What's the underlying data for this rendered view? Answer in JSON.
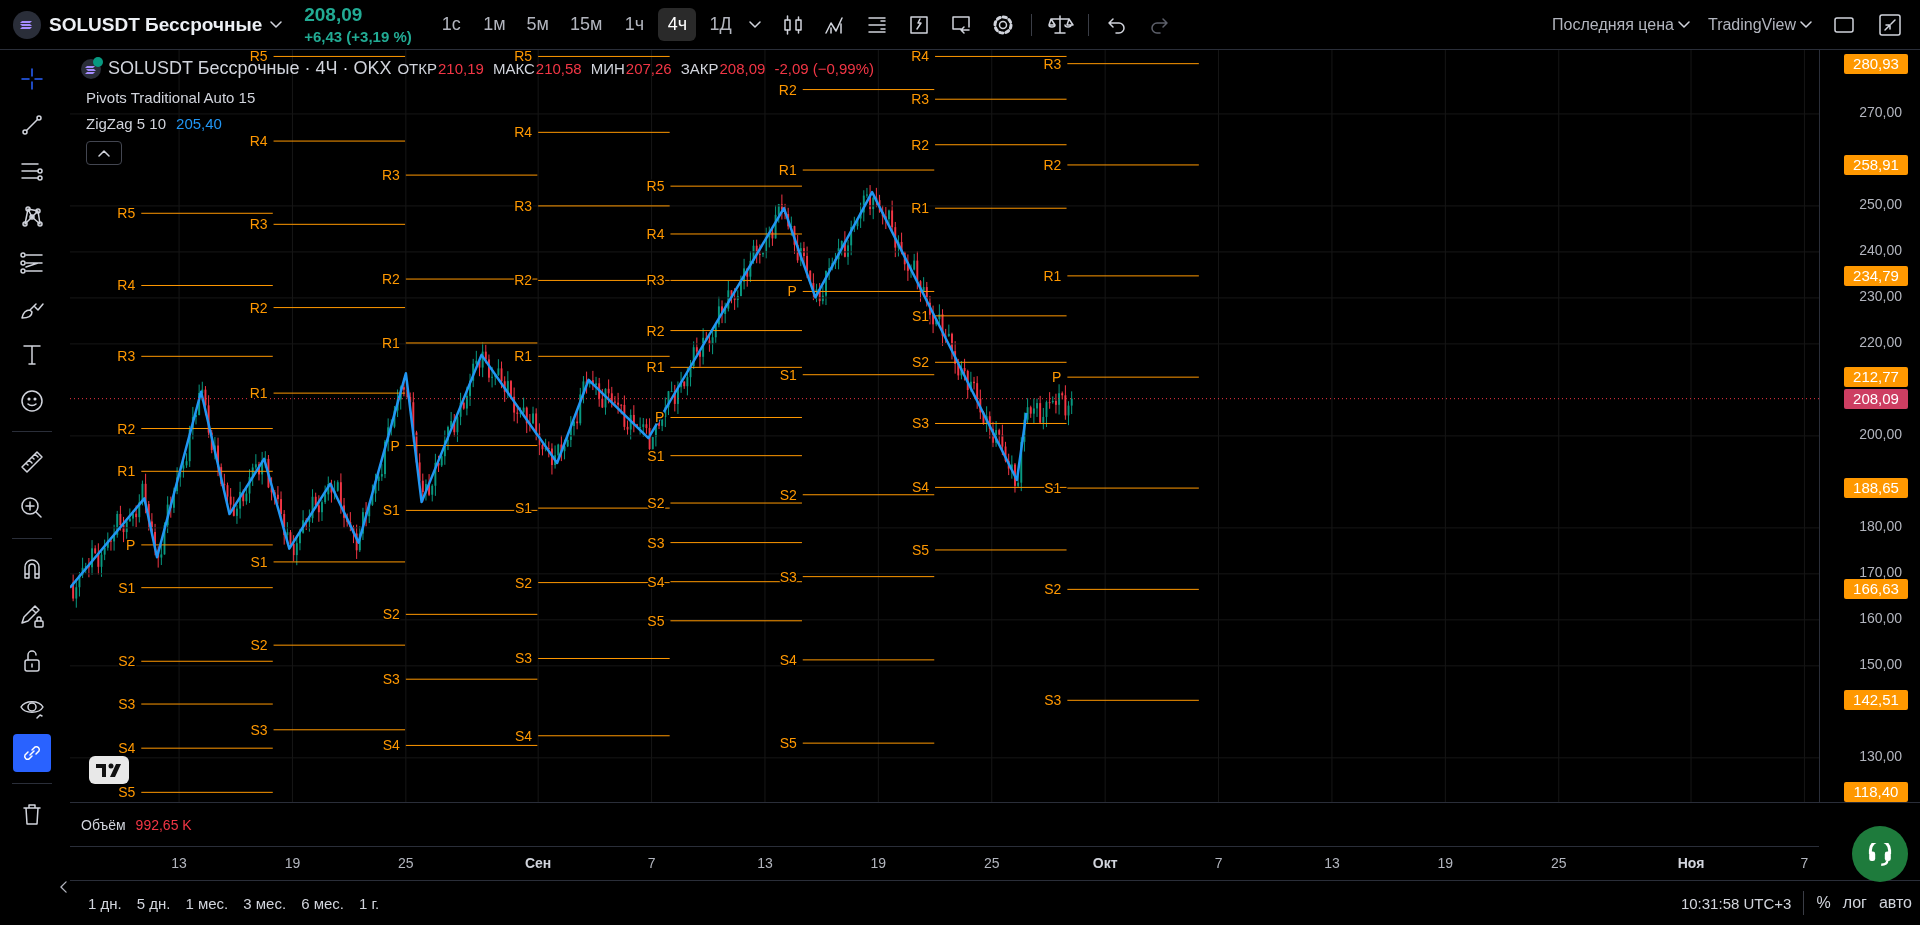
{
  "header": {
    "symbol": "SOLUSDT Бессрочные",
    "price": "208,09",
    "change": "+6,43 (+3,19 %)"
  },
  "intervals": [
    {
      "label": "1с",
      "selected": false
    },
    {
      "label": "1м",
      "selected": false
    },
    {
      "label": "5м",
      "selected": false
    },
    {
      "label": "15м",
      "selected": false
    },
    {
      "label": "1ч",
      "selected": false
    },
    {
      "label": "4ч",
      "selected": true
    },
    {
      "label": "1Д",
      "selected": false
    }
  ],
  "top_tools": [
    {
      "kind": "candles"
    },
    {
      "kind": "indicators"
    },
    {
      "kind": "templates"
    },
    {
      "kind": "alert"
    },
    {
      "kind": "replay"
    },
    {
      "kind": "settings"
    },
    {
      "kind": "divider"
    },
    {
      "kind": "compare"
    },
    {
      "kind": "divider"
    }
  ],
  "history": [
    {
      "kind": "undo",
      "disabled": false
    },
    {
      "kind": "redo",
      "disabled": true
    }
  ],
  "top_right": {
    "price_source": "Последняя цена",
    "layout": "TradingView"
  },
  "drawing_tools": [
    {
      "kind": "crosshair",
      "active": true
    },
    {
      "kind": "trend-line",
      "active": false
    },
    {
      "kind": "parallel-lines",
      "active": false
    },
    {
      "kind": "pattern",
      "active": false
    },
    {
      "kind": "fib",
      "active": false
    },
    {
      "kind": "brush",
      "active": false
    },
    {
      "kind": "text",
      "active": false
    },
    {
      "kind": "emoji",
      "active": false
    },
    {
      "kind": "divider"
    },
    {
      "kind": "ruler",
      "active": false
    },
    {
      "kind": "zoom",
      "active": false
    },
    {
      "kind": "divider"
    },
    {
      "kind": "magnet",
      "active": false
    },
    {
      "kind": "pencil-lock",
      "active": false
    },
    {
      "kind": "lock",
      "active": false
    },
    {
      "kind": "eye",
      "active": false
    },
    {
      "kind": "link",
      "active": true
    },
    {
      "kind": "divider"
    },
    {
      "kind": "trash",
      "active": false
    }
  ],
  "legend": {
    "title": "SOLUSDT Бессрочные · 4Ч · OKX",
    "ohlc": [
      {
        "label": "ОТКР",
        "value": "210,19"
      },
      {
        "label": "МАКС",
        "value": "210,58"
      },
      {
        "label": "МИН",
        "value": "207,26"
      },
      {
        "label": "ЗАКР",
        "value": "208,09"
      }
    ],
    "change": "-2,09 (−0,99%)",
    "indicators": [
      {
        "name": "Pivots Traditional Auto 15"
      },
      {
        "name": "ZigZag 5 10",
        "value": "205,40"
      }
    ]
  },
  "chart": {
    "chart_data": {
      "type": "line",
      "xlim": [
        "--08-07T05:30",
        "--11-07T18:30"
      ],
      "ylim": [
        120.4,
        283.9
      ],
      "grid": true,
      "xticks": [
        {
          "value": "--08-13",
          "label": "13"
        },
        {
          "value": "--08-19",
          "label": "19"
        },
        {
          "value": "--08-25",
          "label": "25"
        },
        {
          "value": "--09-01",
          "label": "Сен"
        },
        {
          "value": "--09-07",
          "label": "7"
        },
        {
          "value": "--09-13",
          "label": "13"
        },
        {
          "value": "--09-19",
          "label": "19"
        },
        {
          "value": "--09-25",
          "label": "25"
        },
        {
          "value": "--10-01",
          "label": "Окт"
        },
        {
          "value": "--10-07",
          "label": "7"
        },
        {
          "value": "--10-13",
          "label": "13"
        },
        {
          "value": "--10-19",
          "label": "19"
        },
        {
          "value": "--10-25",
          "label": "25"
        },
        {
          "value": "--11-01",
          "label": "Ноя"
        },
        {
          "value": "--11-07",
          "label": "7"
        }
      ],
      "yticks": [
        {
          "value": 130,
          "label": "130,00"
        },
        {
          "value": 142.51,
          "label": "142,51"
        },
        {
          "value": 150,
          "label": "150,00"
        },
        {
          "value": 160,
          "label": "160,00"
        },
        {
          "value": 166.63,
          "label": "166,63"
        },
        {
          "value": 170,
          "label": "170,00"
        },
        {
          "value": 180,
          "label": "180,00"
        },
        {
          "value": 188.65,
          "label": "188,65"
        },
        {
          "value": 200,
          "label": "200,00"
        },
        {
          "value": 212.77,
          "label": "212,77"
        },
        {
          "value": 220,
          "label": "220,00"
        },
        {
          "value": 230,
          "label": "230,00"
        },
        {
          "value": 234.79,
          "label": "234,79"
        },
        {
          "value": 240,
          "label": "240,00"
        },
        {
          "value": 250,
          "label": "250,00"
        },
        {
          "value": 258.91,
          "label": "258,91"
        },
        {
          "value": 270,
          "label": "270,00"
        },
        {
          "value": 280.93,
          "label": "280,93"
        }
      ],
      "x": [
        "--08-07T05:30",
        "--08-11T00:00",
        "--08-11T04:00",
        "--08-11T20:00",
        "--08-14T04:00",
        "--08-15T16:00",
        "--08-17T12:00",
        "--08-17T23:00",
        "--08-18T00:00",
        "--08-18T20:00",
        "--08-21T00:00",
        "--08-22T12:00",
        "--08-24T23:00",
        "--08-25T00:00",
        "--08-25T20:00",
        "--08-29T00:00",
        "--08-31T23:00",
        "--09-01T00:00",
        "--09-02T00:00",
        "--09-03T16:00",
        "--09-06T20:00",
        "--09-07T23:00",
        "--09-08T00:00",
        "--09-14T00:00",
        "--09-14T23:00",
        "--09-15T00:00",
        "--09-15T16:00",
        "--09-18T16:00",
        "--09-21T23:00",
        "--09-22T00:00",
        "--09-26T08:00",
        "--09-26T20:00",
        "--09-28T23:00",
        "--09-29T00:00",
        "--10-05T23:00"
      ],
      "series": [
        {
          "color": "#2196f3",
          "values": [
            167,
            185.6,
            186.4,
            173.6,
            209.6,
            183,
            195,
            188.3,
            187.7,
            175.5,
            189.6,
            176.8,
            213.0,
            213.6,
            185.6,
            217.6,
            200.2,
            200.0,
            194.1,
            212.2,
            199.5,
            207.4,
            207.7,
            249.5,
            238.3,
            237.9,
            230.1,
            253,
            226.1,
            225.8,
            190.4,
            205,
            null,
            null,
            null
          ]
        },
        {
          "name": "R5",
          "color": "#ff9800",
          "values": [
            null,
            248.4,
            248.4,
            248.4,
            248.4,
            248.4,
            248.4,
            248.4,
            282.5,
            282.5,
            282.5,
            282.5,
            282.5,
            null,
            null,
            null,
            null,
            282.5,
            282.5,
            282.5,
            282.5,
            282.5,
            254.3,
            254.3,
            254.3,
            null,
            null,
            null,
            null,
            null,
            null,
            null,
            null,
            null,
            null
          ]
        },
        {
          "name": "R4",
          "color": "#ff9800",
          "values": [
            null,
            232.7,
            232.7,
            232.7,
            232.7,
            232.7,
            232.7,
            232.7,
            264.1,
            264.1,
            264.1,
            264.1,
            264.1,
            null,
            null,
            null,
            null,
            266.0,
            266.0,
            266.0,
            266.0,
            266.0,
            243.9,
            243.9,
            243.9,
            null,
            null,
            null,
            null,
            282.5,
            282.5,
            282.5,
            282.5,
            null,
            null
          ]
        },
        {
          "name": "R3",
          "color": "#ff9800",
          "values": [
            null,
            217.3,
            217.3,
            217.3,
            217.3,
            217.3,
            217.3,
            217.3,
            246.0,
            246.0,
            246.0,
            246.0,
            246.0,
            256.7,
            256.7,
            256.7,
            256.7,
            250.0,
            250.0,
            250.0,
            250.0,
            250.0,
            233.8,
            233.8,
            233.8,
            null,
            null,
            null,
            null,
            273.2,
            273.2,
            273.2,
            273.2,
            280.93,
            280.93
          ]
        },
        {
          "name": "R2",
          "color": "#ff9800",
          "values": [
            null,
            201.6,
            201.6,
            201.6,
            201.6,
            201.6,
            201.6,
            201.6,
            227.9,
            227.9,
            227.9,
            227.9,
            227.9,
            234.1,
            234.1,
            234.1,
            234.1,
            233.8,
            233.8,
            233.8,
            233.8,
            233.8,
            222.9,
            222.9,
            222.9,
            275.3,
            275.3,
            275.3,
            275.3,
            263.3,
            263.3,
            263.3,
            263.3,
            258.91,
            258.91
          ]
        },
        {
          "name": "R1",
          "color": "#ff9800",
          "values": [
            null,
            192.3,
            192.3,
            192.3,
            192.3,
            192.3,
            192.3,
            192.3,
            209.3,
            209.3,
            209.3,
            209.3,
            209.3,
            220.2,
            220.2,
            220.2,
            220.2,
            217.3,
            217.3,
            217.3,
            217.3,
            217.3,
            214.9,
            214.9,
            214.9,
            257.8,
            257.8,
            257.8,
            257.8,
            249.5,
            249.5,
            249.5,
            249.5,
            234.79,
            234.79
          ]
        },
        {
          "name": "P",
          "color": "#ff9800",
          "values": [
            null,
            176.3,
            176.3,
            176.3,
            176.3,
            176.3,
            176.3,
            176.3,
            null,
            null,
            null,
            null,
            null,
            197.9,
            197.9,
            197.9,
            197.9,
            null,
            null,
            null,
            null,
            null,
            204.0,
            204.0,
            204.0,
            231.4,
            231.4,
            231.4,
            231.4,
            null,
            null,
            null,
            null,
            212.77,
            212.77
          ]
        },
        {
          "name": "S1",
          "color": "#ff9800",
          "values": [
            null,
            167.0,
            167.0,
            167.0,
            167.0,
            167.0,
            167.0,
            167.0,
            172.6,
            172.6,
            172.6,
            172.6,
            172.6,
            183.8,
            183.8,
            183.8,
            183.8,
            184.3,
            184.3,
            184.3,
            184.3,
            184.3,
            195.7,
            195.7,
            195.7,
            213.3,
            213.3,
            213.3,
            213.3,
            226.1,
            226.1,
            226.1,
            226.1,
            188.65,
            188.65
          ]
        },
        {
          "name": "S2",
          "color": "#ff9800",
          "values": [
            null,
            151.0,
            151.0,
            151.0,
            151.0,
            151.0,
            151.0,
            151.0,
            154.5,
            154.5,
            154.5,
            154.5,
            154.5,
            161.2,
            161.2,
            161.2,
            161.2,
            168.1,
            168.1,
            168.1,
            168.1,
            168.1,
            185.4,
            185.4,
            185.4,
            187.2,
            187.2,
            187.2,
            187.2,
            216.0,
            216.0,
            216.0,
            216.0,
            166.63,
            166.63
          ]
        },
        {
          "name": "S3",
          "color": "#ff9800",
          "values": [
            null,
            141.7,
            141.7,
            141.7,
            141.7,
            141.7,
            141.7,
            141.7,
            136.1,
            136.1,
            136.1,
            136.1,
            136.1,
            147.1,
            147.1,
            147.1,
            147.1,
            151.6,
            151.6,
            151.6,
            151.6,
            151.6,
            176.8,
            176.8,
            176.8,
            169.4,
            169.4,
            169.4,
            169.4,
            202.7,
            202.7,
            202.7,
            202.7,
            142.51,
            142.51
          ]
        },
        {
          "name": "S4",
          "color": "#ff9800",
          "values": [
            null,
            132.1,
            132.1,
            132.1,
            132.1,
            132.1,
            132.1,
            132.1,
            null,
            null,
            null,
            null,
            null,
            132.7,
            132.7,
            132.7,
            132.7,
            134.8,
            134.8,
            134.8,
            134.8,
            134.8,
            168.3,
            168.3,
            168.3,
            151.3,
            151.3,
            151.3,
            151.3,
            188.8,
            188.8,
            188.8,
            188.8,
            null,
            null
          ]
        },
        {
          "name": "S5",
          "color": "#ff9800",
          "values": [
            null,
            122.5,
            122.5,
            122.5,
            122.5,
            122.5,
            122.5,
            122.5,
            null,
            null,
            null,
            null,
            null,
            null,
            null,
            null,
            null,
            null,
            null,
            null,
            null,
            null,
            159.8,
            159.8,
            159.8,
            133.2,
            133.2,
            133.2,
            133.2,
            175.2,
            175.2,
            175.2,
            175.2,
            null,
            null
          ]
        }
      ],
      "ref_lines": [
        {
          "axis": "y",
          "value": 208.09,
          "label": "208,09"
        }
      ],
      "annotations": [
        "118,40"
      ]
    }
  },
  "volume": {
    "label": "Объём",
    "value": "992,65 K"
  },
  "range_buttons": [
    "1 дн.",
    "5 дн.",
    "1 мес.",
    "3 мес.",
    "6 мес.",
    "1 г."
  ],
  "status": {
    "time": "10:31:58 UTC+3",
    "percent": "%",
    "log": "лог",
    "auto": "авто"
  }
}
